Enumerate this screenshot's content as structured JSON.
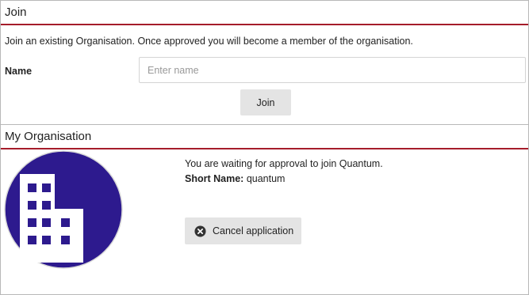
{
  "join": {
    "title": "Join",
    "description": "Join an existing Organisation. Once approved you will become a member of the organisation.",
    "name_label": "Name",
    "name_value": "",
    "name_placeholder": "Enter name",
    "join_button_label": "Join"
  },
  "my_organisation": {
    "title": "My Organisation",
    "avatar_icon": "building-icon",
    "avatar_color": "#2d1a8e",
    "status_text": "You are waiting for approval to join Quantum.",
    "short_name_key": "Short Name:",
    "short_name_value": "quantum",
    "cancel_button_label": "Cancel application",
    "cancel_icon": "close-circle-icon"
  },
  "colors": {
    "accent_rule": "#a51c2a",
    "button_bg": "#e4e4e4"
  }
}
